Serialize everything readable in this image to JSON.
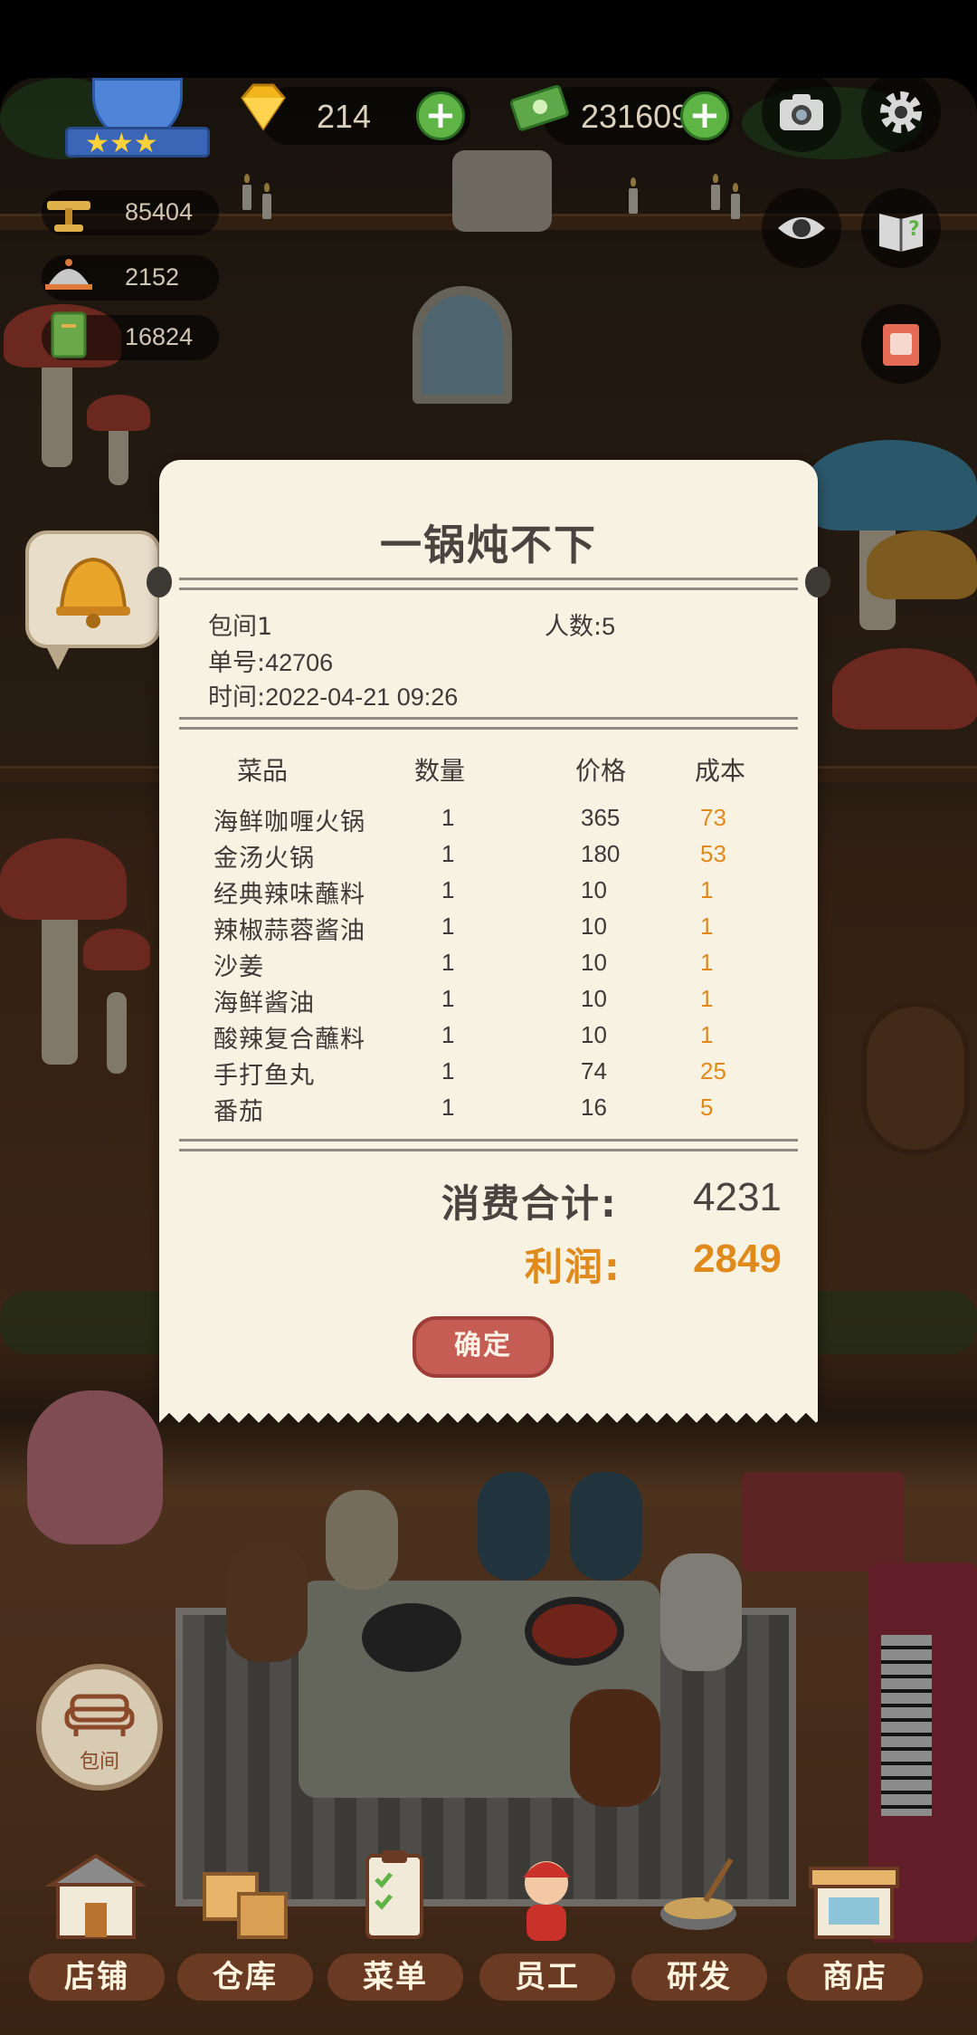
{
  "hud": {
    "gems": "214",
    "cash": "231609",
    "stats": [
      {
        "value": "85404",
        "icon": "scale-icon"
      },
      {
        "value": "2152",
        "icon": "cloche-icon"
      },
      {
        "value": "16824",
        "icon": "menu-book-icon"
      }
    ],
    "star_rating": 3,
    "stars_text": "★★★"
  },
  "receipt": {
    "title": "一锅炖不下",
    "room": "包间1",
    "guests_label": "人数:",
    "guests": "5",
    "order_label": "单号:",
    "order_no": "42706",
    "time_label": "时间:",
    "time": "2022-04-21 09:26",
    "headers": {
      "item": "菜品",
      "qty": "数量",
      "price": "价格",
      "cost": "成本"
    },
    "items": [
      {
        "name": "海鲜咖喱火锅",
        "qty": "1",
        "price": "365",
        "cost": "73"
      },
      {
        "name": "金汤火锅",
        "qty": "1",
        "price": "180",
        "cost": "53"
      },
      {
        "name": "经典辣味蘸料",
        "qty": "1",
        "price": "10",
        "cost": "1"
      },
      {
        "name": "辣椒蒜蓉酱油",
        "qty": "1",
        "price": "10",
        "cost": "1"
      },
      {
        "name": "沙姜",
        "qty": "1",
        "price": "10",
        "cost": "1"
      },
      {
        "name": "海鲜酱油",
        "qty": "1",
        "price": "10",
        "cost": "1"
      },
      {
        "name": "酸辣复合蘸料",
        "qty": "1",
        "price": "10",
        "cost": "1"
      },
      {
        "name": "手打鱼丸",
        "qty": "1",
        "price": "74",
        "cost": "25"
      },
      {
        "name": "番茄",
        "qty": "1",
        "price": "16",
        "cost": "5"
      }
    ],
    "total_label": "消费合计:",
    "total": "4231",
    "profit_label": "利润:",
    "profit": "2849",
    "confirm": "确定"
  },
  "room_button": "包间",
  "nav": [
    {
      "label": "店铺",
      "icon": "shop-icon"
    },
    {
      "label": "仓库",
      "icon": "warehouse-icon"
    },
    {
      "label": "菜单",
      "icon": "clipboard-icon"
    },
    {
      "label": "员工",
      "icon": "staff-icon"
    },
    {
      "label": "研发",
      "icon": "wok-icon"
    },
    {
      "label": "商店",
      "icon": "store-icon"
    }
  ],
  "colors": {
    "accent_orange": "#e08a1c",
    "button_red": "#c65d55",
    "plus_green": "#5fb446"
  }
}
